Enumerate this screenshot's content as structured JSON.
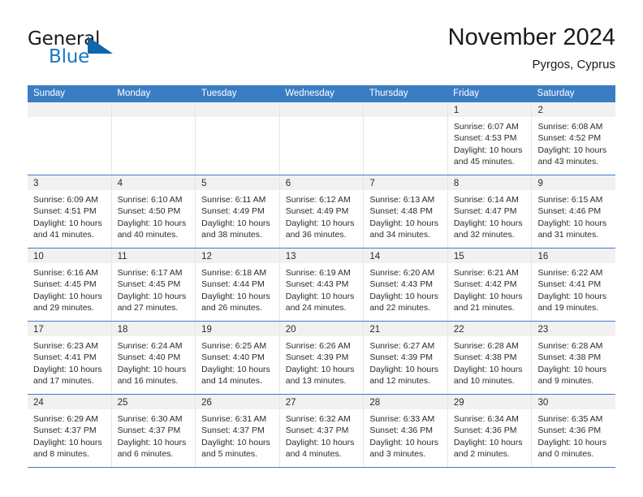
{
  "logo": {
    "word1": "General",
    "word2": "Blue",
    "triangle_color": "#1065ab",
    "text_color": "#1a1a1a",
    "blue_text_color": "#1878be"
  },
  "header": {
    "title": "November 2024",
    "subtitle": "Pyrgos, Cyprus"
  },
  "theme": {
    "header_blue": "#3b7dc4",
    "daynum_bg": "#f1f1f1",
    "text": "#2b2b2b",
    "cell_border": "#e6e6e6"
  },
  "weekdays": [
    "Sunday",
    "Monday",
    "Tuesday",
    "Wednesday",
    "Thursday",
    "Friday",
    "Saturday"
  ],
  "weeks": [
    [
      {
        "empty": true
      },
      {
        "empty": true
      },
      {
        "empty": true
      },
      {
        "empty": true
      },
      {
        "empty": true
      },
      {
        "day": "1",
        "sunrise": "Sunrise: 6:07 AM",
        "sunset": "Sunset: 4:53 PM",
        "daylight": "Daylight: 10 hours and 45 minutes."
      },
      {
        "day": "2",
        "sunrise": "Sunrise: 6:08 AM",
        "sunset": "Sunset: 4:52 PM",
        "daylight": "Daylight: 10 hours and 43 minutes."
      }
    ],
    [
      {
        "day": "3",
        "sunrise": "Sunrise: 6:09 AM",
        "sunset": "Sunset: 4:51 PM",
        "daylight": "Daylight: 10 hours and 41 minutes."
      },
      {
        "day": "4",
        "sunrise": "Sunrise: 6:10 AM",
        "sunset": "Sunset: 4:50 PM",
        "daylight": "Daylight: 10 hours and 40 minutes."
      },
      {
        "day": "5",
        "sunrise": "Sunrise: 6:11 AM",
        "sunset": "Sunset: 4:49 PM",
        "daylight": "Daylight: 10 hours and 38 minutes."
      },
      {
        "day": "6",
        "sunrise": "Sunrise: 6:12 AM",
        "sunset": "Sunset: 4:49 PM",
        "daylight": "Daylight: 10 hours and 36 minutes."
      },
      {
        "day": "7",
        "sunrise": "Sunrise: 6:13 AM",
        "sunset": "Sunset: 4:48 PM",
        "daylight": "Daylight: 10 hours and 34 minutes."
      },
      {
        "day": "8",
        "sunrise": "Sunrise: 6:14 AM",
        "sunset": "Sunset: 4:47 PM",
        "daylight": "Daylight: 10 hours and 32 minutes."
      },
      {
        "day": "9",
        "sunrise": "Sunrise: 6:15 AM",
        "sunset": "Sunset: 4:46 PM",
        "daylight": "Daylight: 10 hours and 31 minutes."
      }
    ],
    [
      {
        "day": "10",
        "sunrise": "Sunrise: 6:16 AM",
        "sunset": "Sunset: 4:45 PM",
        "daylight": "Daylight: 10 hours and 29 minutes."
      },
      {
        "day": "11",
        "sunrise": "Sunrise: 6:17 AM",
        "sunset": "Sunset: 4:45 PM",
        "daylight": "Daylight: 10 hours and 27 minutes."
      },
      {
        "day": "12",
        "sunrise": "Sunrise: 6:18 AM",
        "sunset": "Sunset: 4:44 PM",
        "daylight": "Daylight: 10 hours and 26 minutes."
      },
      {
        "day": "13",
        "sunrise": "Sunrise: 6:19 AM",
        "sunset": "Sunset: 4:43 PM",
        "daylight": "Daylight: 10 hours and 24 minutes."
      },
      {
        "day": "14",
        "sunrise": "Sunrise: 6:20 AM",
        "sunset": "Sunset: 4:43 PM",
        "daylight": "Daylight: 10 hours and 22 minutes."
      },
      {
        "day": "15",
        "sunrise": "Sunrise: 6:21 AM",
        "sunset": "Sunset: 4:42 PM",
        "daylight": "Daylight: 10 hours and 21 minutes."
      },
      {
        "day": "16",
        "sunrise": "Sunrise: 6:22 AM",
        "sunset": "Sunset: 4:41 PM",
        "daylight": "Daylight: 10 hours and 19 minutes."
      }
    ],
    [
      {
        "day": "17",
        "sunrise": "Sunrise: 6:23 AM",
        "sunset": "Sunset: 4:41 PM",
        "daylight": "Daylight: 10 hours and 17 minutes."
      },
      {
        "day": "18",
        "sunrise": "Sunrise: 6:24 AM",
        "sunset": "Sunset: 4:40 PM",
        "daylight": "Daylight: 10 hours and 16 minutes."
      },
      {
        "day": "19",
        "sunrise": "Sunrise: 6:25 AM",
        "sunset": "Sunset: 4:40 PM",
        "daylight": "Daylight: 10 hours and 14 minutes."
      },
      {
        "day": "20",
        "sunrise": "Sunrise: 6:26 AM",
        "sunset": "Sunset: 4:39 PM",
        "daylight": "Daylight: 10 hours and 13 minutes."
      },
      {
        "day": "21",
        "sunrise": "Sunrise: 6:27 AM",
        "sunset": "Sunset: 4:39 PM",
        "daylight": "Daylight: 10 hours and 12 minutes."
      },
      {
        "day": "22",
        "sunrise": "Sunrise: 6:28 AM",
        "sunset": "Sunset: 4:38 PM",
        "daylight": "Daylight: 10 hours and 10 minutes."
      },
      {
        "day": "23",
        "sunrise": "Sunrise: 6:28 AM",
        "sunset": "Sunset: 4:38 PM",
        "daylight": "Daylight: 10 hours and 9 minutes."
      }
    ],
    [
      {
        "day": "24",
        "sunrise": "Sunrise: 6:29 AM",
        "sunset": "Sunset: 4:37 PM",
        "daylight": "Daylight: 10 hours and 8 minutes."
      },
      {
        "day": "25",
        "sunrise": "Sunrise: 6:30 AM",
        "sunset": "Sunset: 4:37 PM",
        "daylight": "Daylight: 10 hours and 6 minutes."
      },
      {
        "day": "26",
        "sunrise": "Sunrise: 6:31 AM",
        "sunset": "Sunset: 4:37 PM",
        "daylight": "Daylight: 10 hours and 5 minutes."
      },
      {
        "day": "27",
        "sunrise": "Sunrise: 6:32 AM",
        "sunset": "Sunset: 4:37 PM",
        "daylight": "Daylight: 10 hours and 4 minutes."
      },
      {
        "day": "28",
        "sunrise": "Sunrise: 6:33 AM",
        "sunset": "Sunset: 4:36 PM",
        "daylight": "Daylight: 10 hours and 3 minutes."
      },
      {
        "day": "29",
        "sunrise": "Sunrise: 6:34 AM",
        "sunset": "Sunset: 4:36 PM",
        "daylight": "Daylight: 10 hours and 2 minutes."
      },
      {
        "day": "30",
        "sunrise": "Sunrise: 6:35 AM",
        "sunset": "Sunset: 4:36 PM",
        "daylight": "Daylight: 10 hours and 0 minutes."
      }
    ]
  ]
}
